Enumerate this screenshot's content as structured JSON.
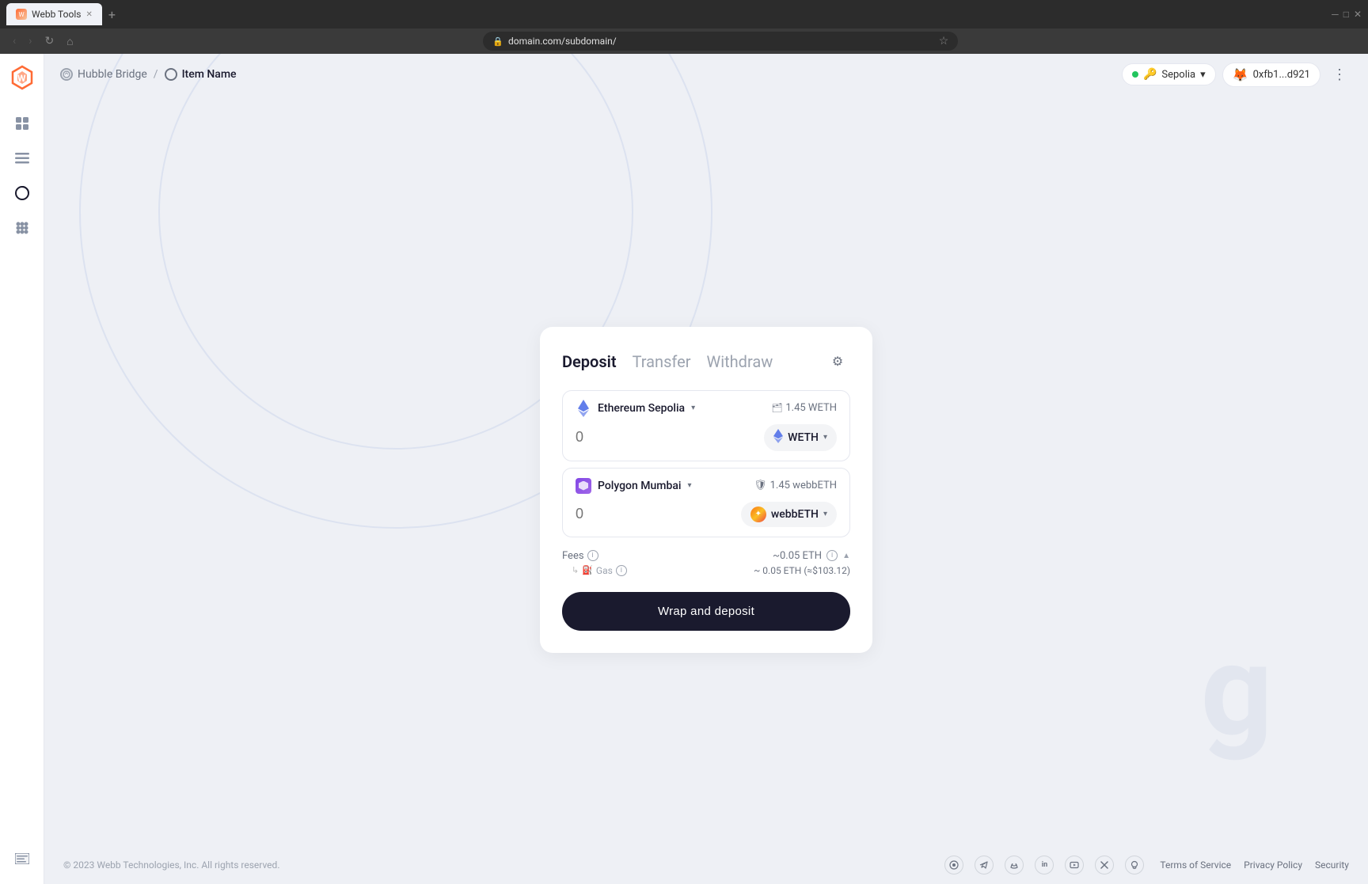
{
  "browser": {
    "tab_title": "Webb Tools",
    "tab_icon": "✕",
    "url": "domain.com/subdomain/",
    "new_tab": "+"
  },
  "header": {
    "breadcrumb_parent": "Hubble Bridge",
    "breadcrumb_separator": "/",
    "breadcrumb_current": "Item Name",
    "network_label": "Sepolia",
    "wallet_label": "0xfb1...d921",
    "more_icon": "⋮"
  },
  "sidebar": {
    "logo_text": "W",
    "items": [
      {
        "id": "grid",
        "icon": "⊞"
      },
      {
        "id": "list",
        "icon": "☰"
      },
      {
        "id": "circle",
        "icon": "◎"
      },
      {
        "id": "apps",
        "icon": "⊠"
      }
    ],
    "bottom": [
      {
        "id": "terminal",
        "icon": "▤"
      }
    ]
  },
  "card": {
    "tabs": [
      {
        "label": "Deposit",
        "active": true
      },
      {
        "label": "Transfer",
        "active": false
      },
      {
        "label": "Withdraw",
        "active": false
      }
    ],
    "settings_icon": "⚙",
    "source_chain": {
      "name": "Ethereum Sepolia",
      "balance": "1.45 WETH",
      "amount_placeholder": "0",
      "token": "WETH",
      "chevron": "▾"
    },
    "dest_chain": {
      "name": "Polygon Mumbai",
      "balance": "1.45 webbETH",
      "amount_placeholder": "0",
      "token": "webbETH",
      "chevron": "▾"
    },
    "fees": {
      "label": "Fees",
      "amount": "~0.05 ETH",
      "gas_label": "Gas",
      "gas_value": "~ 0.05 ETH (≈$103.12)"
    },
    "cta_label": "Wrap and deposit"
  },
  "footer": {
    "copyright": "© 2023 Webb Technologies, Inc. All rights reserved.",
    "social_icons": [
      {
        "id": "gitbook",
        "symbol": "◉"
      },
      {
        "id": "telegram",
        "symbol": "✈"
      },
      {
        "id": "discord",
        "symbol": "⬡"
      },
      {
        "id": "linkedin",
        "symbol": "in"
      },
      {
        "id": "youtube",
        "symbol": "▶"
      },
      {
        "id": "twitter",
        "symbol": "𝕏"
      },
      {
        "id": "github",
        "symbol": "⌥"
      }
    ],
    "links": [
      {
        "label": "Terms of Service",
        "id": "tos"
      },
      {
        "label": "Privacy Policy",
        "id": "privacy"
      },
      {
        "label": "Security",
        "id": "security"
      }
    ]
  }
}
